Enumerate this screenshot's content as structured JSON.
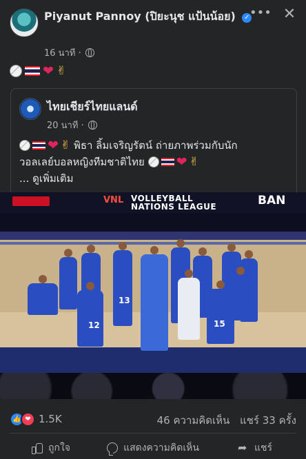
{
  "post": {
    "author": "Piyanut Pannoy (ปิยะนุช แป้นน้อย)",
    "time": "16 นาที",
    "more_label": "•••",
    "close_label": "✕"
  },
  "shared": {
    "page_name": "ไทยเชียร์ไทยแลนด์",
    "time": "20 นาที",
    "text_line1": "พิธา ลิ้มเจริญรัตน์ ถ่ายภาพร่วมกับนัก",
    "text_line2": "วอลเลย์บอลหญิงทีมชาติไทย",
    "see_more": "... ดูเพิ่มเติม"
  },
  "photo": {
    "banner_logo": "VNL",
    "banner_text_1": "VOLLEYBALL",
    "banner_text_2": "NATIONS LEAGUE",
    "banner_right": "BAN",
    "jersey_numbers": [
      "13",
      "12",
      "15"
    ]
  },
  "engagement": {
    "reaction_count": "1.5K",
    "comments": "46 ความคิดเห็น",
    "shares": "แชร์ 33 ครั้ง"
  },
  "actions": {
    "like": "ถูกใจ",
    "comment": "แสดงความคิดเห็น",
    "share": "แชร์"
  },
  "icons": [
    "globe-icon",
    "verified-icon",
    "volleyball-emoji",
    "thai-flag-emoji",
    "red-heart-emoji",
    "victory-hand-emoji",
    "like-icon",
    "comment-icon",
    "share-icon"
  ],
  "colors": {
    "background": "#242526",
    "accent": "#2d88ff",
    "text": "#e4e6eb",
    "muted": "#b0b3b8"
  }
}
